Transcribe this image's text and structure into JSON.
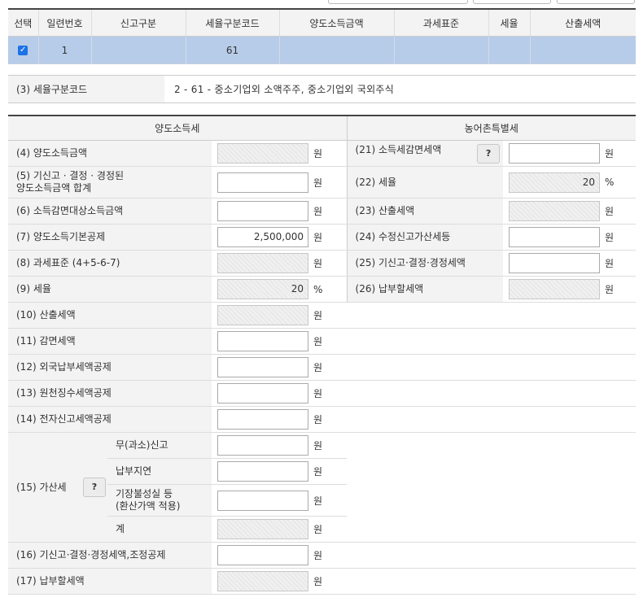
{
  "grid": {
    "headers": [
      "선택",
      "일련번호",
      "신고구분",
      "세율구분코드",
      "양도소득금액",
      "과세표준",
      "세율",
      "산출세액"
    ],
    "row": {
      "serial": "1",
      "report_type": "",
      "rate_code": "61",
      "transfer_income": "",
      "tax_base": "",
      "rate": "",
      "computed_tax": ""
    }
  },
  "rate_code": {
    "label": "(3) 세율구분코드",
    "value": "2  -  61  -  중소기업외 소액주주, 중소기업외 국외주식"
  },
  "sections": {
    "left": "양도소득세",
    "right": "농어촌특별세"
  },
  "left_rows": [
    {
      "label": "(4) 양도소득금액",
      "value": "",
      "unit": "원"
    },
    {
      "label": "(5) 기신고 · 결정 · 경정된",
      "label2": "양도소득금액 합계",
      "value": "",
      "unit": "원"
    },
    {
      "label": "(6) 소득감면대상소득금액",
      "value": "",
      "unit": "원"
    },
    {
      "label": "(7) 양도소득기본공제",
      "value": "2,500,000",
      "unit": "원"
    },
    {
      "label": "(8) 과세표준 (4+5-6-7)",
      "value": "",
      "unit": "원"
    },
    {
      "label": "(9) 세율",
      "value": "20",
      "unit": "%"
    },
    {
      "label": "(10) 산출세액",
      "value": "",
      "unit": "원"
    },
    {
      "label": "(11) 감면세액",
      "value": "",
      "unit": "원"
    },
    {
      "label": "(12) 외국납부세액공제",
      "value": "",
      "unit": "원"
    },
    {
      "label": "(13) 원천징수세액공제",
      "value": "",
      "unit": "원"
    },
    {
      "label": "(14) 전자신고세액공제",
      "value": "",
      "unit": "원"
    }
  ],
  "right_rows": [
    {
      "label": "(21) 소득세감면세액",
      "value": "",
      "unit": "원",
      "help": "?"
    },
    {
      "label": "(22) 세율",
      "value": "20",
      "unit": "%"
    },
    {
      "label": "(23) 산출세액",
      "value": "",
      "unit": "원"
    },
    {
      "label": "(24) 수정신고가산세등",
      "value": "",
      "unit": "원"
    },
    {
      "label": "(25) 기신고·결정·경정세액",
      "value": "",
      "unit": "원"
    },
    {
      "label": "(26) 납부할세액",
      "value": "",
      "unit": "원"
    }
  ],
  "penalty": {
    "label": "(15) 가산세",
    "help": "?",
    "items": [
      {
        "label": "무(과소)신고",
        "value": "",
        "unit": "원"
      },
      {
        "label": "납부지연",
        "value": "",
        "unit": "원"
      },
      {
        "label": "기장불성실 등",
        "label2": "(환산가액 적용)",
        "value": "",
        "unit": "원"
      },
      {
        "label": "계",
        "value": "",
        "unit": "원"
      }
    ]
  },
  "bottom_rows": [
    {
      "label": "(16) 기신고·결정·경정세액,조정공제",
      "value": "",
      "unit": "원"
    },
    {
      "label": "(17) 납부할세액",
      "value": "",
      "unit": "원"
    }
  ]
}
